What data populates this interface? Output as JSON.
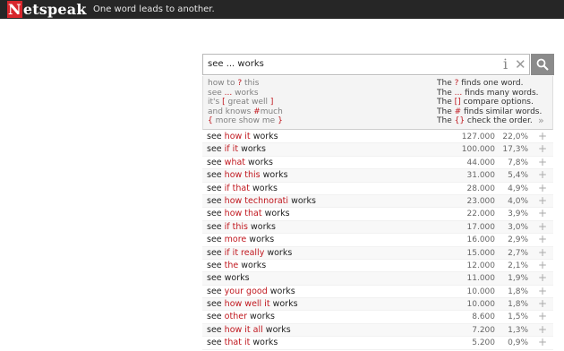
{
  "header": {
    "logo_text": "Netspeak",
    "tagline": "One word leads to another."
  },
  "search": {
    "query": "see ... works",
    "info_icon": "info-icon",
    "clear_icon": "close-icon",
    "button_icon": "search-icon"
  },
  "help": {
    "examples": [
      {
        "pre": "how to ",
        "op": "?",
        "post": " this"
      },
      {
        "pre": "see ",
        "op": "...",
        "post": " works"
      },
      {
        "pre": "it's ",
        "op": "[",
        "mid": " great well ",
        "op2": "]",
        "post": ""
      },
      {
        "pre": "and knows ",
        "op": "#",
        "post": "much"
      },
      {
        "pre": "",
        "op": "{",
        "mid": " more show me ",
        "op2": "}",
        "post": ""
      }
    ],
    "rules": [
      {
        "pre": "The ",
        "op": "?",
        "post": " finds one word."
      },
      {
        "pre": "The ",
        "op": "...",
        "post": " finds many words."
      },
      {
        "pre": "The ",
        "op": "[]",
        "post": " compare options."
      },
      {
        "pre": "The ",
        "op": "#",
        "post": " finds similar words."
      },
      {
        "pre": "The ",
        "op": "{}",
        "post": " check the order."
      }
    ],
    "more_icon": "double-chevron-right-icon"
  },
  "results": [
    {
      "pre": "see ",
      "word": "how it",
      "post": " works",
      "count": "127.000",
      "percent": "22,0%"
    },
    {
      "pre": "see ",
      "word": "if it",
      "post": " works",
      "count": "100.000",
      "percent": "17,3%"
    },
    {
      "pre": "see ",
      "word": "what",
      "post": " works",
      "count": "44.000",
      "percent": "7,8%"
    },
    {
      "pre": "see ",
      "word": "how this",
      "post": " works",
      "count": "31.000",
      "percent": "5,4%"
    },
    {
      "pre": "see ",
      "word": "if that",
      "post": " works",
      "count": "28.000",
      "percent": "4,9%"
    },
    {
      "pre": "see ",
      "word": "how technorati",
      "post": " works",
      "count": "23.000",
      "percent": "4,0%"
    },
    {
      "pre": "see ",
      "word": "how that",
      "post": " works",
      "count": "22.000",
      "percent": "3,9%"
    },
    {
      "pre": "see ",
      "word": "if this",
      "post": " works",
      "count": "17.000",
      "percent": "3,0%"
    },
    {
      "pre": "see ",
      "word": "more",
      "post": " works",
      "count": "16.000",
      "percent": "2,9%"
    },
    {
      "pre": "see ",
      "word": "if it really",
      "post": " works",
      "count": "15.000",
      "percent": "2,7%"
    },
    {
      "pre": "see ",
      "word": "the",
      "post": " works",
      "count": "12.000",
      "percent": "2,1%"
    },
    {
      "pre": "see",
      "word": "",
      "post": " works",
      "count": "11.000",
      "percent": "1,9%"
    },
    {
      "pre": "see ",
      "word": "your good",
      "post": " works",
      "count": "10.000",
      "percent": "1,8%"
    },
    {
      "pre": "see ",
      "word": "how well it",
      "post": " works",
      "count": "10.000",
      "percent": "1,8%"
    },
    {
      "pre": "see ",
      "word": "other",
      "post": " works",
      "count": "8.600",
      "percent": "1,5%"
    },
    {
      "pre": "see ",
      "word": "how it all",
      "post": " works",
      "count": "7.200",
      "percent": "1,3%"
    },
    {
      "pre": "see ",
      "word": "that it",
      "post": " works",
      "count": "5.200",
      "percent": "0,9%"
    }
  ],
  "colors": {
    "brand_red": "#d8262c",
    "highlight_red": "#c0171e",
    "topbar": "#262626"
  }
}
